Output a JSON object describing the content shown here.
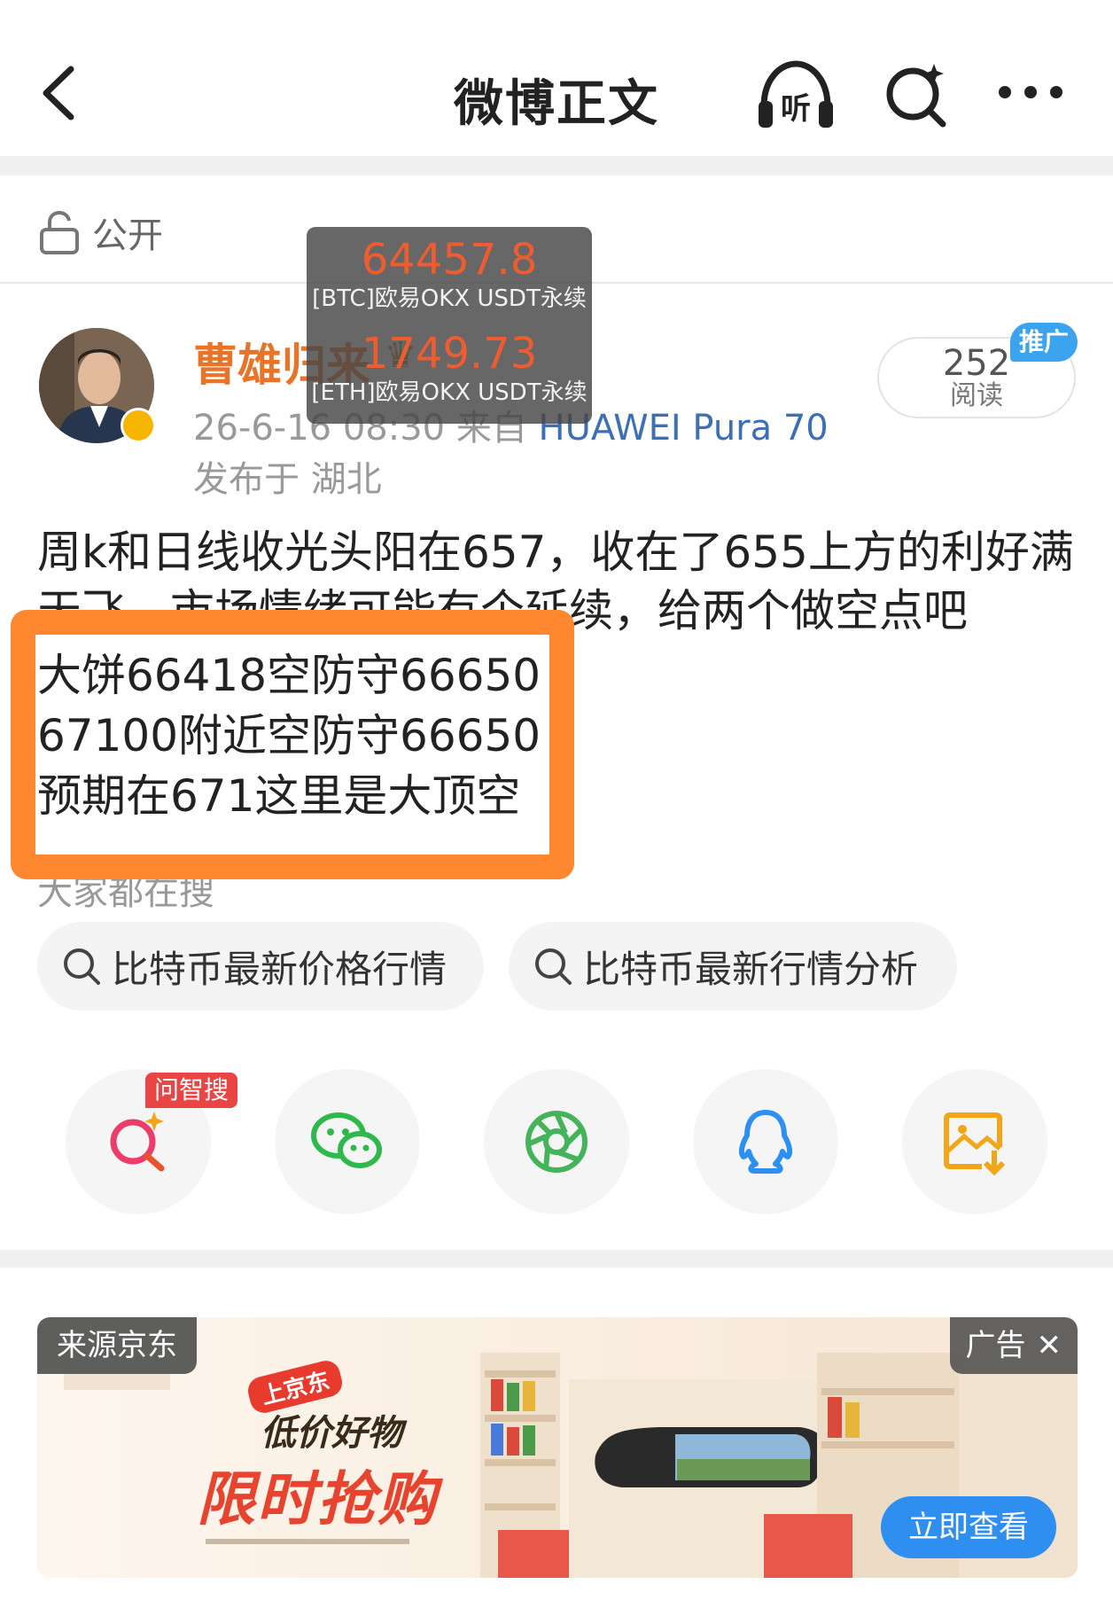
{
  "header": {
    "title": "微博正文",
    "listen_icon_text": "听"
  },
  "visibility": {
    "label": "公开"
  },
  "author": {
    "name": "曹雄归来",
    "meta": "26-6-16 08:30  来自",
    "device": "HUAWEI Pura 70",
    "location": "发布于 湖北"
  },
  "read_count": {
    "value": "252",
    "label": "阅读",
    "promo": "推广"
  },
  "ticker": [
    {
      "price": "64457.8",
      "name": "[BTC]欧易OKX USDT永续"
    },
    {
      "price": "1749.73",
      "name": "[ETH]欧易OKX USDT永续"
    }
  ],
  "post": {
    "line1": "周k和日线收光头阳在657，收在了655上方的利好满",
    "line2": "天飞，市场情绪可能有个延续，给两个做空点吧",
    "highlight": [
      "大饼66418空防守66650",
      "67100附近空防守66650",
      "预期在671这里是大顶空"
    ]
  },
  "trending": {
    "label": "大家都在搜",
    "chips": [
      "比特币最新价格行情",
      "比特币最新行情分析"
    ]
  },
  "share": {
    "ai_badge": "问智搜"
  },
  "ad": {
    "source": "来源京东",
    "tag": "广告",
    "close": "✕",
    "brand": "上京东",
    "slogan": "低价好物",
    "headline": "限时抢购",
    "cta": "立即查看"
  },
  "colors": {
    "accent_orange": "#ff8730",
    "name_orange": "#e8742a",
    "price_red": "#ee5c2f",
    "link_blue": "#3b6fb6",
    "cta_blue": "#2e8ff0"
  }
}
